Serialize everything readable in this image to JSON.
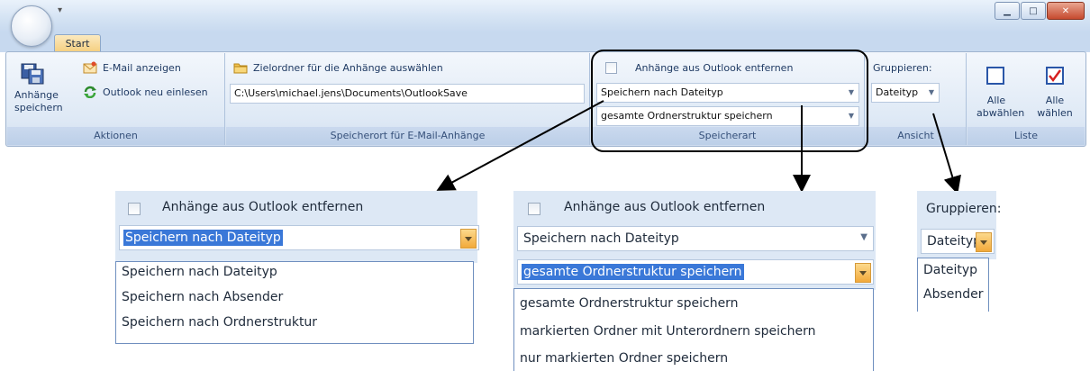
{
  "ribbon": {
    "tab": "Start",
    "aktionen": {
      "save_attachments": "Anhänge speichern",
      "show_email": "E-Mail anzeigen",
      "reload": "Outlook neu einlesen",
      "group_label": "Aktionen"
    },
    "speicherort": {
      "choose_folder": "Zielordner für die Anhänge auswählen",
      "path": "C:\\Users\\michael.jens\\Documents\\OutlookSave",
      "group_label": "Speicherort für E-Mail-Anhänge"
    },
    "speicherart": {
      "remove_checkbox": "Anhänge aus Outlook entfernen",
      "save_mode": "Speichern nach Dateityp",
      "structure_mode": "gesamte Ordnerstruktur speichern",
      "group_label": "Speicherart"
    },
    "ansicht": {
      "group_by_label": "Gruppieren:",
      "group_by_value": "Dateityp",
      "group_label": "Ansicht"
    },
    "liste": {
      "deselect_all": "Alle abwählen",
      "select_all": "Alle wählen",
      "group_label": "Liste"
    }
  },
  "zoom_left": {
    "checkbox_label": "Anhänge aus Outlook entfernen",
    "selected": "Speichern nach Dateityp",
    "options": [
      "Speichern nach Dateityp",
      "Speichern nach Absender",
      "Speichern nach Ordnerstruktur"
    ]
  },
  "zoom_middle": {
    "checkbox_label": "Anhänge aus Outlook entfernen",
    "save_mode": "Speichern nach Dateityp",
    "selected": "gesamte Ordnerstruktur speichern",
    "options": [
      "gesamte Ordnerstruktur speichern",
      "markierten Ordner mit Unterordnern speichern",
      "nur markierten Ordner speichern"
    ]
  },
  "zoom_right": {
    "label": "Gruppieren:",
    "selected": "Dateityp",
    "options": [
      "Dateityp",
      "Absender"
    ]
  },
  "icons": {
    "save": "floppy-disks-icon",
    "email": "envelope-icon",
    "reload": "refresh-arrows-icon",
    "folder": "folder-icon",
    "deselect": "empty-checkbox-icon",
    "select": "checked-checkbox-icon"
  },
  "colors": {
    "ribbon_bg": "#dde8f5",
    "selection": "#3a78d8",
    "dropdown_arrow": "#f2a93b"
  }
}
